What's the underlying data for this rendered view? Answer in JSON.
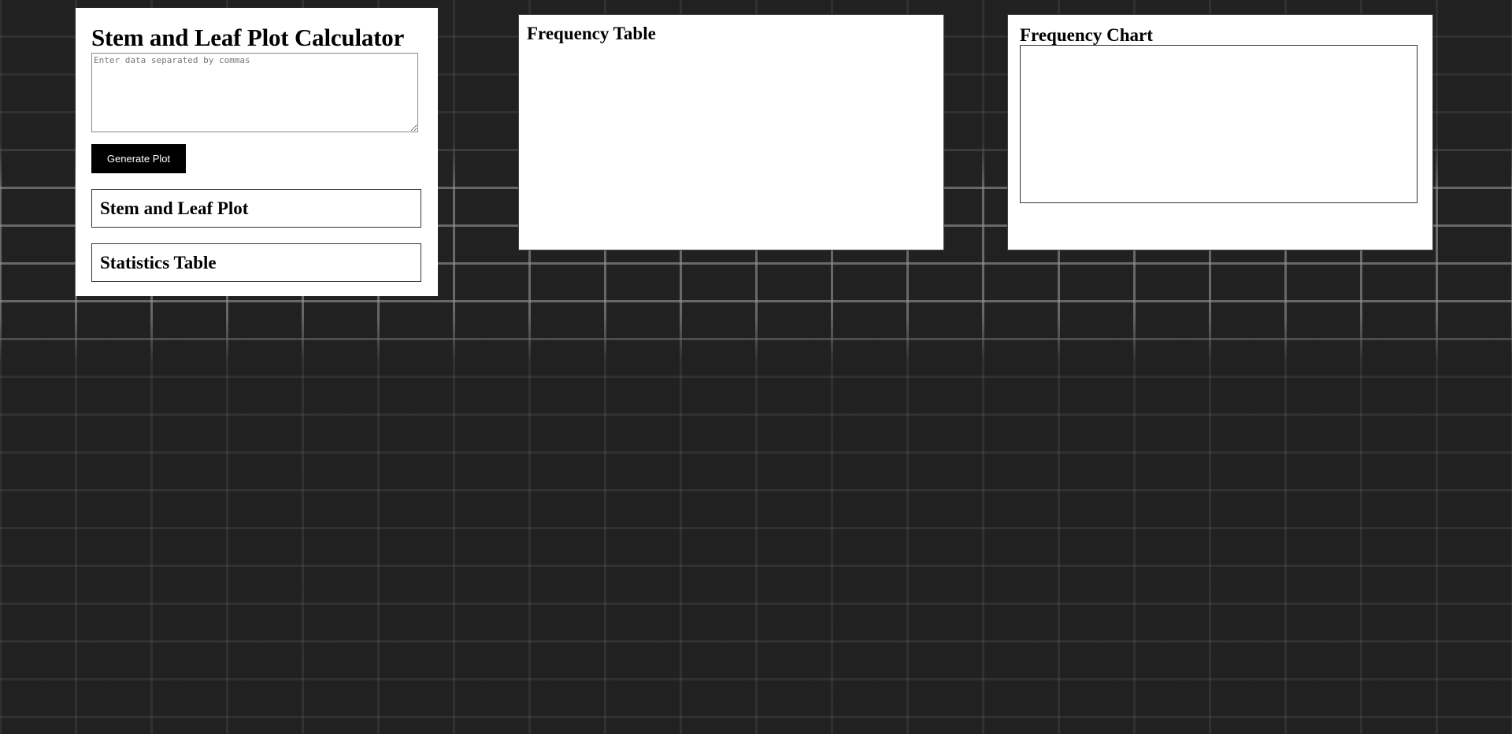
{
  "calculator": {
    "title": "Stem and Leaf Plot Calculator",
    "input_placeholder": "Enter data separated by commas",
    "input_value": "",
    "generate_button_label": "Generate Plot",
    "stem_leaf_heading": "Stem and Leaf Plot",
    "statistics_heading": "Statistics Table"
  },
  "frequency_table": {
    "heading": "Frequency Table"
  },
  "frequency_chart": {
    "heading": "Frequency Chart"
  },
  "colors": {
    "page_background": "#212121",
    "panel_background": "#ffffff",
    "button_background": "#000000",
    "button_text": "#ffffff"
  }
}
